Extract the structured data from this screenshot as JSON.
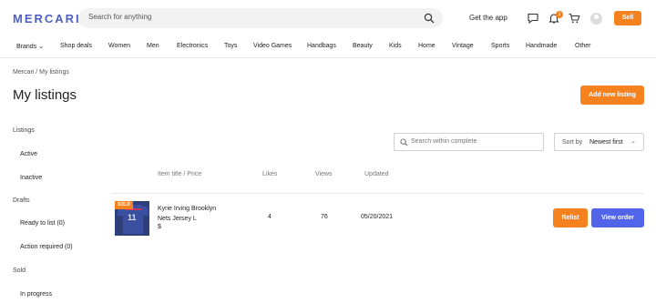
{
  "header": {
    "logo": "MERCARI",
    "search_placeholder": "Search for anything",
    "get_app": "Get the app",
    "notification_count": "1",
    "sell_label": "Sell"
  },
  "nav": {
    "items": [
      "Brands ⌄",
      "Shop deals",
      "Women",
      "Men",
      "Electronics",
      "Toys",
      "Video Games",
      "Handbags",
      "Beauty",
      "Kids",
      "Home",
      "Vintage",
      "Sports",
      "Handmade",
      "Other"
    ]
  },
  "breadcrumb": "Mercari / My listings",
  "page_title": "My listings",
  "add_listing_label": "Add new listing",
  "sidebar": {
    "listings_heading": "Listings",
    "active": "Active",
    "inactive": "Inactive",
    "drafts_heading": "Drafts",
    "ready_to_list": "Ready to list (0)",
    "action_required": "Action required (0)",
    "sold_heading": "Sold",
    "in_progress": "In progress"
  },
  "controls": {
    "search_placeholder": "Search within complete",
    "sort_label": "Sort by",
    "sort_value": "Newest first"
  },
  "table": {
    "headers": {
      "title_price": "Item title / Price",
      "likes": "Likes",
      "views": "Views",
      "updated": "Updated"
    },
    "rows": [
      {
        "badge": "SOLD",
        "title": "Kyrie Irving Brooklyn Nets Jersey L",
        "price": "$",
        "likes": "4",
        "views": "76",
        "updated": "05/20/2021",
        "relist_label": "Relist",
        "view_order_label": "View order"
      }
    ]
  },
  "colors": {
    "brand": "#4e5fc1",
    "accent_orange": "#f5821f",
    "accent_blue": "#5264ea"
  }
}
